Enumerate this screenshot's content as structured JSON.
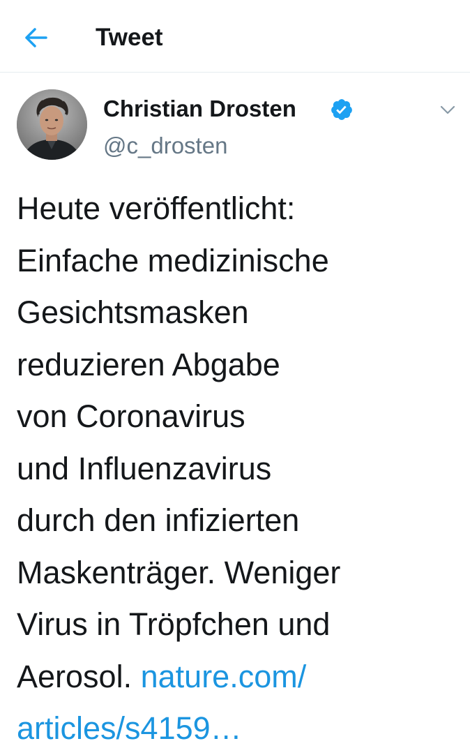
{
  "header": {
    "title": "Tweet",
    "back_icon": "arrow-left-icon",
    "accent_color": "#1da1f2"
  },
  "tweet": {
    "author": {
      "display_name": "Christian Drosten",
      "handle": "@c_drosten",
      "verified": true,
      "verified_icon": "verified-badge-icon",
      "verified_color": "#1da1f2"
    },
    "menu_icon": "chevron-down-icon",
    "text_lines": [
      "Heute veröffentlicht:",
      "Einfache medizinische",
      "Gesichtsmasken",
      "reduzieren Abgabe",
      "von Coronavirus",
      "und Influenzavirus",
      "durch den infizierten",
      "Maskenträger. Weniger",
      "Virus in Tröpfchen und"
    ],
    "last_line_text": "Aerosol.",
    "link_part1": "nature.com/",
    "link_part2": "articles/s4159…",
    "link_color": "#1b95e0"
  }
}
